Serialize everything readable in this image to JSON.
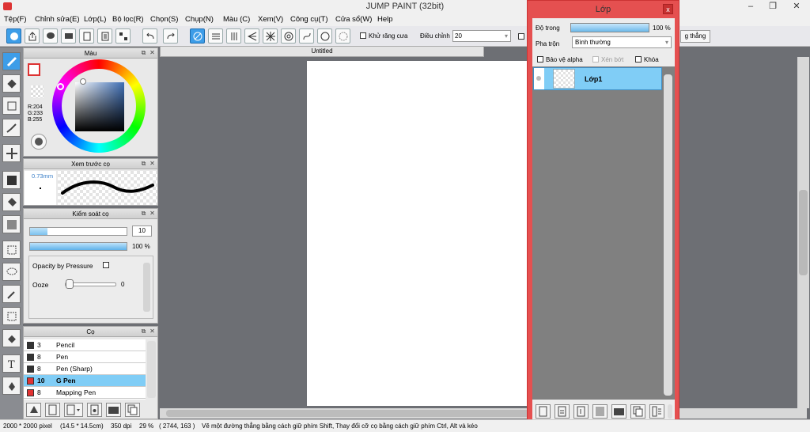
{
  "app": {
    "title": "JUMP PAINT (32bit)",
    "minimize": "–",
    "maximize": "❐",
    "close": "✕"
  },
  "menu": [
    "Tệp(F)",
    "Chỉnh sửa(E)",
    "Lớp(L)",
    "Bộ lọc(R)",
    "Chọn(S)",
    "Chụp(N)",
    "Màu (C)",
    "Xem(V)",
    "Công cụ(T)",
    "Cửa sổ(W)",
    "Help"
  ],
  "toolbar": {
    "antialias_label": "Khử răng cưa",
    "adjust_label": "Điều chỉnh",
    "adjust_value": "20",
    "straight_label": "g thẳng"
  },
  "document": {
    "tab_title": "Untitled"
  },
  "color_panel": {
    "title": "Màu",
    "r": "R:204",
    "g": "G:233",
    "b": "B:255",
    "fg": "#cce9ff",
    "accent": "#d33b3b"
  },
  "brush_preview": {
    "title": "Xem trước cọ",
    "size": "0.73mm"
  },
  "brush_control": {
    "title": "Kiểm soát cọ",
    "size_value": "10",
    "opacity_value": "100 %",
    "pressure_label": "Opacity by Pressure",
    "ooze_label": "Ooze",
    "ooze_value": "0"
  },
  "brushes": {
    "title": "Cọ",
    "items": [
      {
        "size": "3",
        "name": "Pencil",
        "color": "#333333",
        "selected": false
      },
      {
        "size": "8",
        "name": "Pen",
        "color": "#333333",
        "selected": false
      },
      {
        "size": "8",
        "name": "Pen (Sharp)",
        "color": "#333333",
        "selected": false
      },
      {
        "size": "10",
        "name": "G Pen",
        "color": "#e33333",
        "selected": true
      },
      {
        "size": "8",
        "name": "Mapping Pen",
        "color": "#e33333",
        "selected": false
      }
    ]
  },
  "layer_window": {
    "title": "Lớp",
    "close": "x",
    "opacity_label": "Độ trong",
    "opacity_value": "100 %",
    "opacity_level": 1.0,
    "blend_label": "Pha trộn",
    "blend_value": "Bình thường",
    "protect_alpha": "Bảo vệ alpha",
    "clipping": "Xén bớt",
    "lock": "Khóa",
    "layer_name": "Lớp1"
  },
  "status": {
    "size": "2000 * 2000 pixel",
    "cm": "(14.5 * 14.5cm)",
    "dpi": "350 dpi",
    "zoom": "29 %",
    "coords": "( 2744, 163 )",
    "hint": "Vẽ một đường thẳng bằng cách giữ phím Shift, Thay đổi cỡ cọ bằng cách giữ phím Ctrl, Alt và kéo"
  }
}
